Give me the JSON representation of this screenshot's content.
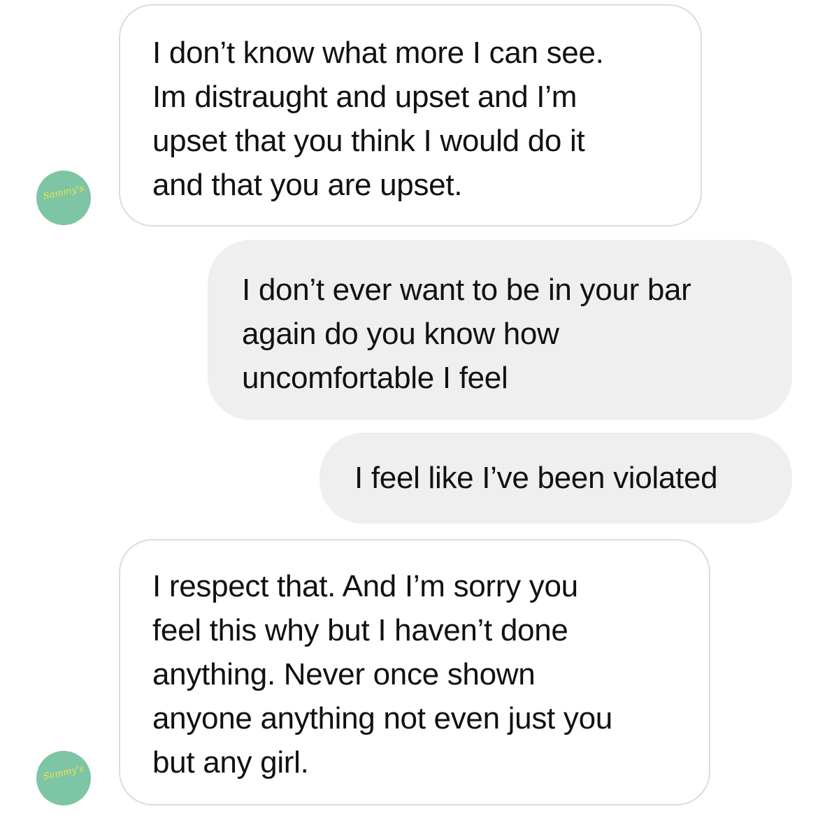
{
  "contact": {
    "avatar_text": "Sammy's"
  },
  "messages": [
    {
      "sender": "contact",
      "lines": [
        "I don’t know what more I can see.",
        "Im distraught and upset and I’m",
        "upset that you think I would do it",
        "and that you are upset."
      ]
    },
    {
      "sender": "me",
      "lines": [
        "I don’t ever want to be in your bar",
        "again do you know how",
        "uncomfortable I feel"
      ]
    },
    {
      "sender": "me",
      "lines": [
        "I feel like I’ve been violated"
      ]
    },
    {
      "sender": "contact",
      "lines": [
        "I respect that. And I’m sorry you",
        "feel this why but I haven’t done",
        "anything. Never once shown",
        "anyone anything not even just you",
        "but any girl."
      ]
    }
  ],
  "colors": {
    "incoming_bubble": "#ffffff",
    "incoming_border": "#dcdcdc",
    "outgoing_bubble": "#efefef",
    "avatar_bg": "#7dc5a4",
    "avatar_text": "#f2e24a"
  }
}
